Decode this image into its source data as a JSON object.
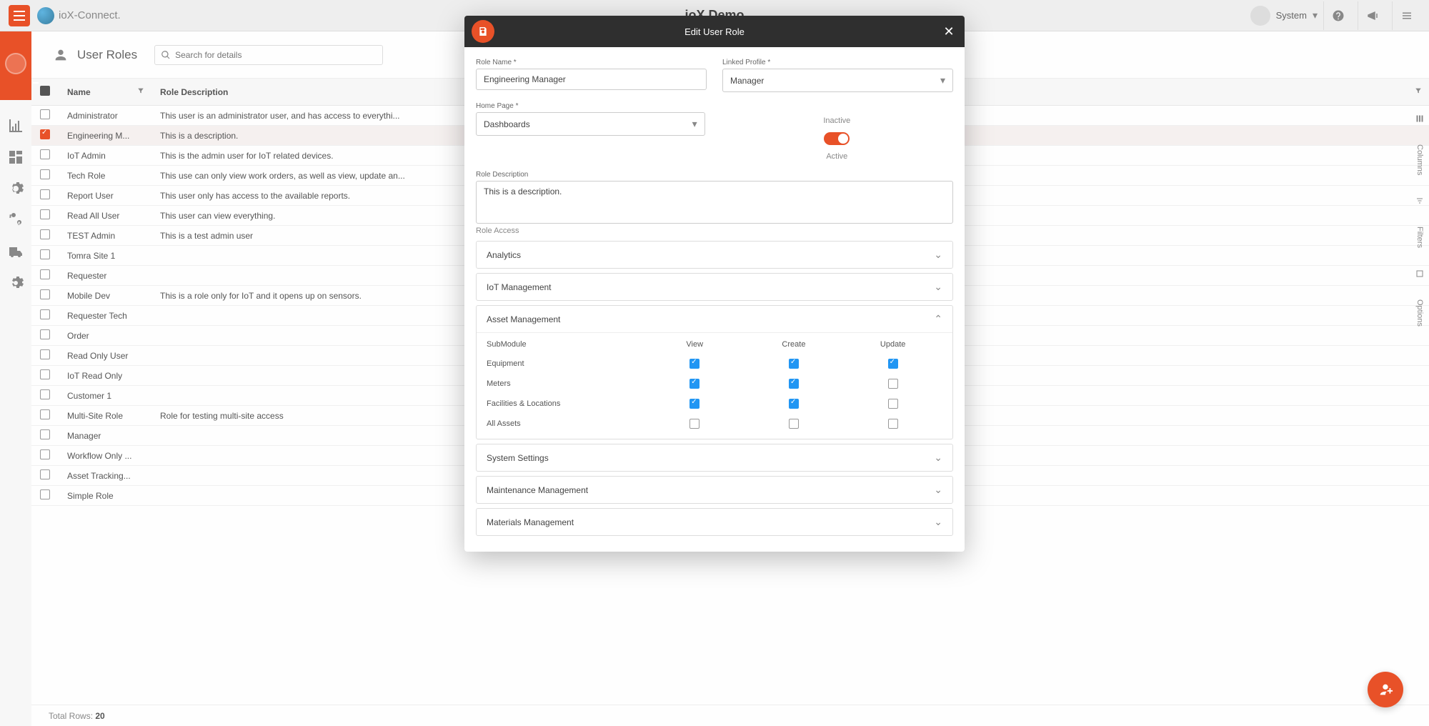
{
  "header": {
    "brand": "ioX-Connect.",
    "siteTitle": "ioX Demo",
    "userLabel": "System"
  },
  "page": {
    "title": "User Roles",
    "searchPlaceholder": "Search for details"
  },
  "columns": {
    "name": "Name",
    "desc": "Role Description"
  },
  "rows": [
    {
      "name": "Administrator",
      "desc": "This user is an administrator user, and has access to everythi...",
      "selected": false
    },
    {
      "name": "Engineering M...",
      "desc": "This is a description.",
      "selected": true
    },
    {
      "name": "IoT Admin",
      "desc": "This is the admin user for IoT related devices.",
      "selected": false
    },
    {
      "name": "Tech Role",
      "desc": "This use can only view work orders, as well as view, update an...",
      "selected": false
    },
    {
      "name": "Report User",
      "desc": "This user only has access to the available reports.",
      "selected": false
    },
    {
      "name": "Read All User",
      "desc": "This user can view everything.",
      "selected": false
    },
    {
      "name": "TEST Admin",
      "desc": "This is a test admin user",
      "selected": false
    },
    {
      "name": "Tomra Site 1",
      "desc": "",
      "selected": false
    },
    {
      "name": "Requester",
      "desc": "",
      "selected": false
    },
    {
      "name": "Mobile Dev",
      "desc": "This is a role only for IoT and it opens up on sensors.",
      "selected": false
    },
    {
      "name": "Requester Tech",
      "desc": "",
      "selected": false
    },
    {
      "name": "Order",
      "desc": "",
      "selected": false
    },
    {
      "name": "Read Only User",
      "desc": "",
      "selected": false
    },
    {
      "name": "IoT Read Only",
      "desc": "",
      "selected": false
    },
    {
      "name": "Customer 1",
      "desc": "",
      "selected": false
    },
    {
      "name": "Multi-Site Role",
      "desc": "Role for testing multi-site access",
      "selected": false
    },
    {
      "name": "Manager",
      "desc": "",
      "selected": false
    },
    {
      "name": "Workflow Only ...",
      "desc": "",
      "selected": false
    },
    {
      "name": "Asset Tracking...",
      "desc": "",
      "selected": false
    },
    {
      "name": "Simple Role",
      "desc": "",
      "selected": false
    }
  ],
  "footer": {
    "label": "Total Rows:",
    "count": "20"
  },
  "rail": {
    "columns": "Columns",
    "filters": "Filters",
    "options": "Options"
  },
  "modal": {
    "title": "Edit User Role",
    "labels": {
      "roleName": "Role Name *",
      "linkedProfile": "Linked Profile *",
      "homePage": "Home Page *",
      "inactive": "Inactive",
      "active": "Active",
      "roleDesc": "Role Description",
      "roleAccess": "Role Access"
    },
    "values": {
      "roleName": "Engineering Manager",
      "linkedProfile": "Manager",
      "homePage": "Dashboards",
      "roleDesc": "This is a description."
    },
    "sections": {
      "analytics": "Analytics",
      "iot": "IoT Management",
      "asset": "Asset Management",
      "system": "System Settings",
      "maint": "Maintenance Management",
      "materials": "Materials Management"
    },
    "permHeaders": {
      "sub": "SubModule",
      "view": "View",
      "create": "Create",
      "update": "Update"
    },
    "perms": [
      {
        "label": "Equipment",
        "view": true,
        "create": true,
        "update": true
      },
      {
        "label": "Meters",
        "view": true,
        "create": true,
        "update": false
      },
      {
        "label": "Facilities & Locations",
        "view": true,
        "create": true,
        "update": false
      },
      {
        "label": "All Assets",
        "view": false,
        "create": false,
        "update": false
      }
    ]
  }
}
